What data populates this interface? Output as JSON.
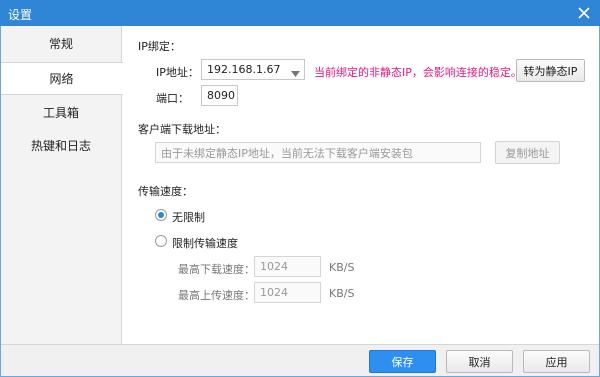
{
  "window": {
    "title": "设置"
  },
  "sidebar": {
    "items": [
      {
        "label": "常规",
        "active": false
      },
      {
        "label": "网络",
        "active": true
      },
      {
        "label": "工具箱",
        "active": false
      },
      {
        "label": "热键和日志",
        "active": false
      }
    ]
  },
  "ip_binding": {
    "section_label": "IP绑定：",
    "ip_label": "IP地址：",
    "ip_value": "192.168.1.67",
    "warning": "当前绑定的非静态IP，会影响连接的稳定。",
    "to_static_button": "转为静态IP",
    "port_label": "端口：",
    "port_value": "8090"
  },
  "download": {
    "section_label": "客户端下载地址：",
    "placeholder": "由于未绑定静态IP地址，当前无法下载客户端安装包",
    "copy_button": "复制地址"
  },
  "speed": {
    "section_label": "传输速度：",
    "unlimited_label": "无限制",
    "limited_label": "限制传输速度",
    "selected": "unlimited",
    "max_download_label": "最高下载速度：",
    "max_download_value": "1024",
    "max_download_unit": "KB/S",
    "max_upload_label": "最高上传速度：",
    "max_upload_value": "1024",
    "max_upload_unit": "KB/S"
  },
  "footer": {
    "save_button": "保存",
    "cancel_button": "取消",
    "apply_button": "应用"
  },
  "colors": {
    "titlebar": "#2f86d6",
    "warning": "#e0197d",
    "primary_button": "#2f8ff0"
  }
}
